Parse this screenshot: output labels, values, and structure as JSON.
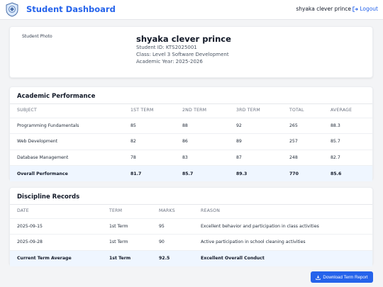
{
  "header": {
    "title": "Student Dashboard",
    "user_name": "shyaka clever prince",
    "logout_label": "Logout"
  },
  "profile": {
    "photo_alt": "Student Photo",
    "name": "shyaka clever prince",
    "student_id": "Student ID: KTS2025001",
    "class": "Class: Level 3 Software Development",
    "academic_year": "Academic Year: 2025-2026"
  },
  "performance": {
    "title": "Academic Performance",
    "headers": [
      "SUBJECT",
      "1ST TERM",
      "2ND TERM",
      "3RD TERM",
      "TOTAL",
      "AVERAGE"
    ],
    "rows": [
      [
        "Programming Fundamentals",
        "85",
        "88",
        "92",
        "265",
        "88.3"
      ],
      [
        "Web Development",
        "82",
        "86",
        "89",
        "257",
        "85.7"
      ],
      [
        "Database Management",
        "78",
        "83",
        "87",
        "248",
        "82.7"
      ]
    ],
    "summary": [
      "Overall Performance",
      "81.7",
      "85.7",
      "89.3",
      "770",
      "85.6"
    ]
  },
  "discipline": {
    "title": "Discipline Records",
    "headers": [
      "DATE",
      "TERM",
      "MARKS",
      "REASON"
    ],
    "rows": [
      [
        "2025-09-15",
        "1st Term",
        "95",
        "Excellent behavior and participation in class activities"
      ],
      [
        "2025-09-28",
        "1st Term",
        "90",
        "Active participation in school cleaning activities"
      ]
    ],
    "summary": [
      "Current Term Average",
      "1st Term",
      "92.5",
      "Excellent Overall Conduct"
    ]
  },
  "actions": {
    "download_label": "Download Term Report"
  },
  "colors": {
    "accent": "#2563eb",
    "summary_bg": "#eff6ff",
    "page_bg": "#f3f4f6"
  },
  "icons": {
    "logo": "school-crest-icon",
    "logout": "logout-icon",
    "download": "download-icon"
  }
}
